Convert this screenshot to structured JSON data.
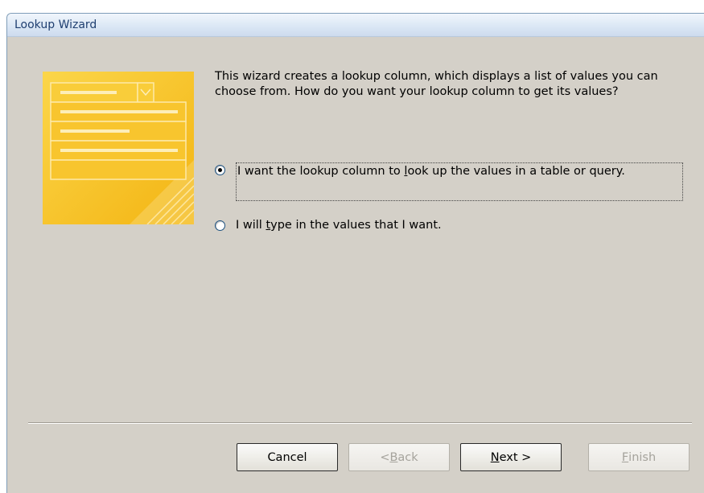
{
  "window": {
    "title": "Lookup Wizard"
  },
  "intro_text": "This wizard creates a lookup column, which displays a list of values you can choose from.  How do you want your lookup column to get its values?",
  "options": [
    {
      "pre": "I want the lookup column to ",
      "accel": "l",
      "post": "ook up the values in a table or query.",
      "selected": true
    },
    {
      "pre": "I will ",
      "accel": "t",
      "post": "ype in the values that I want.",
      "selected": false
    }
  ],
  "buttons": {
    "cancel": {
      "label": "Cancel",
      "enabled": true
    },
    "back": {
      "pre": "< ",
      "accel": "B",
      "post": "ack",
      "enabled": false
    },
    "next": {
      "accel": "N",
      "post": "ext >",
      "enabled": true
    },
    "finish": {
      "accel": "F",
      "post": "inish",
      "enabled": false
    }
  },
  "colors": {
    "dialog_bg": "#d4d0c8",
    "title_text": "#1f3f70",
    "art_yellow": "#f7c42a"
  },
  "icons": {
    "wizard_art": "lookup-list-illustration"
  }
}
